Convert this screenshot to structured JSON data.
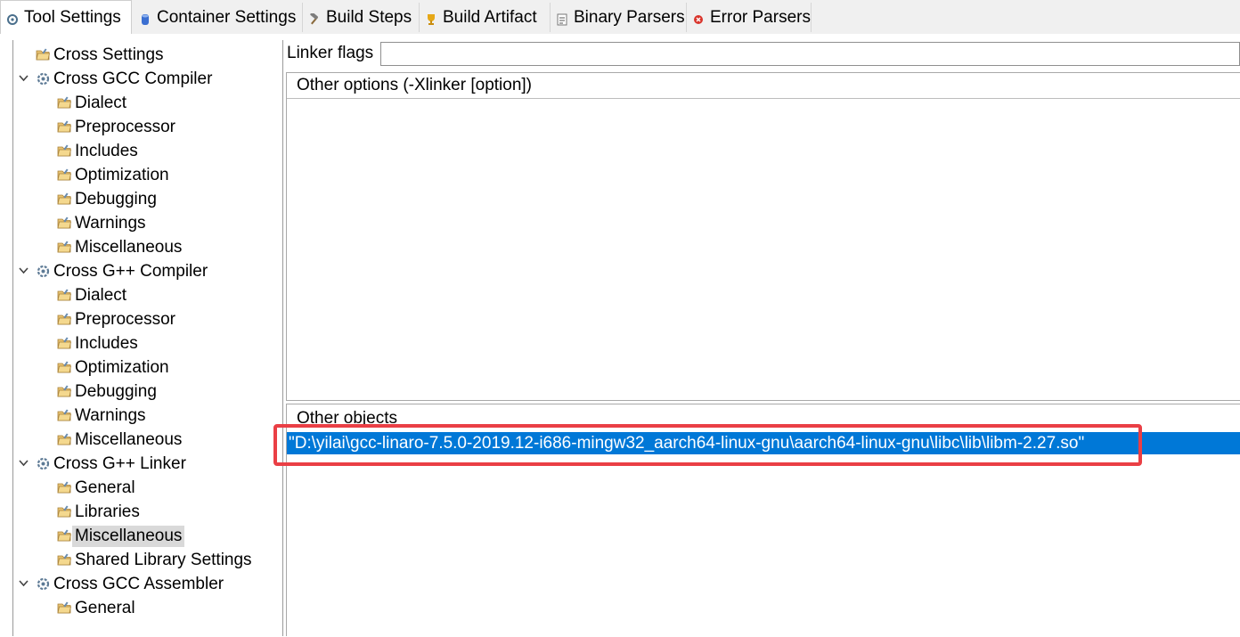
{
  "tabs": [
    {
      "label": "Tool Settings",
      "icon": "gears-icon",
      "active": true
    },
    {
      "label": "Container Settings",
      "icon": "container-icon",
      "active": false
    },
    {
      "label": "Build Steps",
      "icon": "hammer-icon",
      "active": false
    },
    {
      "label": "Build Artifact",
      "icon": "trophy-icon",
      "active": false
    },
    {
      "label": "Binary Parsers",
      "icon": "binary-file-icon",
      "active": false
    },
    {
      "label": "Error Parsers",
      "icon": "error-icon",
      "active": false
    }
  ],
  "tree": {
    "nodes": [
      {
        "label": "Cross Settings",
        "type": "folder"
      },
      {
        "label": "Cross GCC Compiler",
        "type": "tool",
        "expanded": true
      },
      {
        "label": "Dialect",
        "type": "folder"
      },
      {
        "label": "Preprocessor",
        "type": "folder"
      },
      {
        "label": "Includes",
        "type": "folder"
      },
      {
        "label": "Optimization",
        "type": "folder"
      },
      {
        "label": "Debugging",
        "type": "folder"
      },
      {
        "label": "Warnings",
        "type": "folder"
      },
      {
        "label": "Miscellaneous",
        "type": "folder"
      },
      {
        "label": "Cross G++ Compiler",
        "type": "tool",
        "expanded": true
      },
      {
        "label": "Dialect",
        "type": "folder"
      },
      {
        "label": "Preprocessor",
        "type": "folder"
      },
      {
        "label": "Includes",
        "type": "folder"
      },
      {
        "label": "Optimization",
        "type": "folder"
      },
      {
        "label": "Debugging",
        "type": "folder"
      },
      {
        "label": "Warnings",
        "type": "folder"
      },
      {
        "label": "Miscellaneous",
        "type": "folder"
      },
      {
        "label": "Cross G++ Linker",
        "type": "tool",
        "expanded": true
      },
      {
        "label": "General",
        "type": "folder"
      },
      {
        "label": "Libraries",
        "type": "folder"
      },
      {
        "label": "Miscellaneous",
        "type": "folder",
        "selected": true
      },
      {
        "label": "Shared Library Settings",
        "type": "folder"
      },
      {
        "label": "Cross GCC Assembler",
        "type": "tool",
        "expanded": true
      },
      {
        "label": "General",
        "type": "folder"
      }
    ]
  },
  "linker_flags": {
    "label": "Linker flags",
    "value": ""
  },
  "other_options": {
    "title": "Other options (-Xlinker [option])",
    "items": []
  },
  "other_objects": {
    "title": "Other objects",
    "items": [
      "\"D:\\yilai\\gcc-linaro-7.5.0-2019.12-i686-mingw32_aarch64-linux-gnu\\aarch64-linux-gnu\\libc\\lib\\libm-2.27.so\""
    ]
  },
  "colors": {
    "selection": "#0078d7",
    "highlight_box": "#ea3f45",
    "tree_selected": "#d9d9d9"
  }
}
